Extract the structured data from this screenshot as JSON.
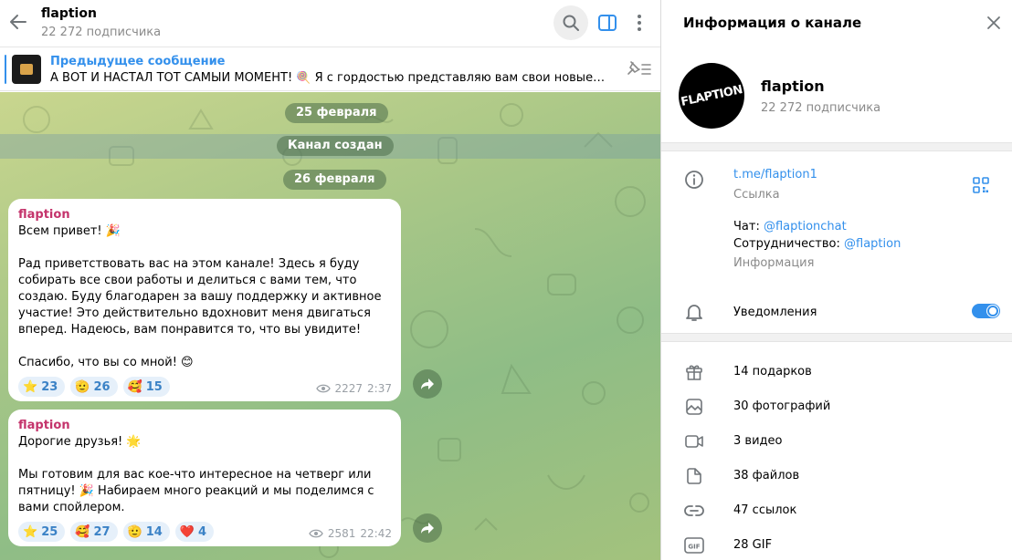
{
  "header": {
    "title": "flaption",
    "subscribers": "22 272 подписчика"
  },
  "pinned": {
    "title": "Предыдущее сообщение",
    "text": "А ВОТ И НАСТАЛ ТОТ САМЫЙ МОМЕНТ! 🍭 Я с гордостью представляю вам свои новые концеп..."
  },
  "dates": {
    "first": "25 февраля",
    "created": "Канал создан",
    "second": "26 февраля"
  },
  "messages": [
    {
      "author": "flaption",
      "text": "Всем привет! 🎉\n\nРад приветствовать вас на этом канале! Здесь я буду собирать все свои работы и делиться с вами тем, что создаю. Буду благодарен за вашу поддержку и активное участие! Это действительно вдохновит меня двигаться вперед. Надеюсь, вам понравится то, что вы увидите!\n\nСпасибо, что вы со мной! 😊",
      "reactions": [
        {
          "emoji": "⭐",
          "count": "23"
        },
        {
          "emoji": "🫡",
          "count": "26"
        },
        {
          "emoji": "🥰",
          "count": "15"
        }
      ],
      "views": "2227",
      "time": "2:37"
    },
    {
      "author": "flaption",
      "text": "Дорогие друзья! 🌟\n\nМы готовим для вас кое-что интересное на четверг или пятницу! 🎉 Набираем много реакций и мы поделимся с вами спойлером.",
      "reactions": [
        {
          "emoji": "⭐",
          "count": "25"
        },
        {
          "emoji": "🥰",
          "count": "27"
        },
        {
          "emoji": "🫡",
          "count": "14"
        },
        {
          "emoji": "❤️",
          "count": "4"
        }
      ],
      "views": "2581",
      "time": "22:42"
    }
  ],
  "info": {
    "title": "Информация о канале",
    "name": "flaption",
    "subscribers": "22 272 подписчика",
    "avatar_text": "FLAPTION",
    "link": "t.me/flaption1",
    "link_label": "Ссылка",
    "chat_prefix": "Чат: ",
    "chat_link": "@flaptionchat",
    "collab_prefix": "Сотрудничество: ",
    "collab_link": "@flaption",
    "desc_label": "Информация",
    "notifications": "Уведомления",
    "notifications_on": true,
    "media": [
      {
        "icon": "gift-icon",
        "label": "14 подарков"
      },
      {
        "icon": "photo-icon",
        "label": "30 фотографий"
      },
      {
        "icon": "video-icon",
        "label": "3 видео"
      },
      {
        "icon": "file-icon",
        "label": "38 файлов"
      },
      {
        "icon": "link-icon",
        "label": "47 ссылок"
      },
      {
        "icon": "gif-icon",
        "label": "28 GIF"
      }
    ]
  },
  "colors": {
    "accent": "#3390ec",
    "author": "#c4336b",
    "reaction_bg": "#e6f0fa"
  }
}
